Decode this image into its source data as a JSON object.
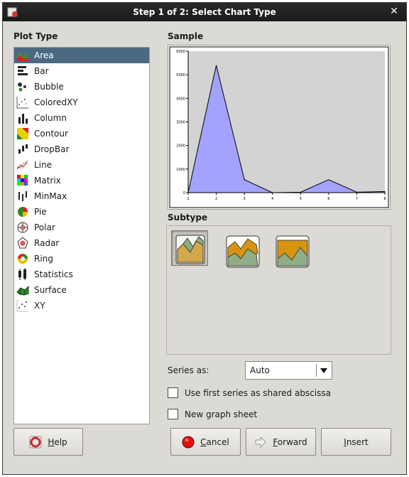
{
  "window": {
    "title": "Step 1 of 2: Select Chart Type"
  },
  "plot_type": {
    "heading": "Plot Type",
    "items": [
      "Area",
      "Bar",
      "Bubble",
      "ColoredXY",
      "Column",
      "Contour",
      "DropBar",
      "Line",
      "Matrix",
      "MinMax",
      "Pie",
      "Polar",
      "Radar",
      "Ring",
      "Statistics",
      "Surface",
      "XY"
    ],
    "selected": "Area"
  },
  "sample": {
    "heading": "Sample",
    "chart_data": {
      "type": "area",
      "x": [
        1,
        2,
        3,
        4,
        5,
        6,
        7,
        8
      ],
      "xticks": [
        "1",
        "2",
        "3",
        "4",
        "5",
        "6",
        "7",
        "8"
      ],
      "yticks": [
        "0",
        "1000",
        "2000",
        "3000",
        "4000",
        "5000",
        "6000"
      ],
      "series": [
        {
          "values": [
            0,
            5400,
            550,
            0,
            20,
            550,
            20,
            50
          ]
        }
      ],
      "xlim": [
        1,
        8
      ],
      "ylim": [
        0,
        6000
      ],
      "grid": false,
      "area_color": "#a3a3ff",
      "plot_background": "#d3d3d3"
    }
  },
  "subtype": {
    "heading": "Subtype",
    "options": [
      "stacked-area-icon",
      "percent-area-icon",
      "overlay-area-icon"
    ],
    "selected_index": 0
  },
  "series_as": {
    "label": "Series as:",
    "value": "Auto"
  },
  "checkboxes": {
    "shared_abscissa": {
      "label": "Use first series as shared abscissa",
      "checked": false
    },
    "new_sheet": {
      "label": "New graph sheet",
      "checked": false
    }
  },
  "buttons": {
    "help": "Help",
    "cancel": "Cancel",
    "forward": "Forward",
    "insert": "Insert"
  },
  "colors": {
    "selection": "#4b6983",
    "dialog_bg": "#dcdad5",
    "titlebar": "#1f1f1f"
  }
}
